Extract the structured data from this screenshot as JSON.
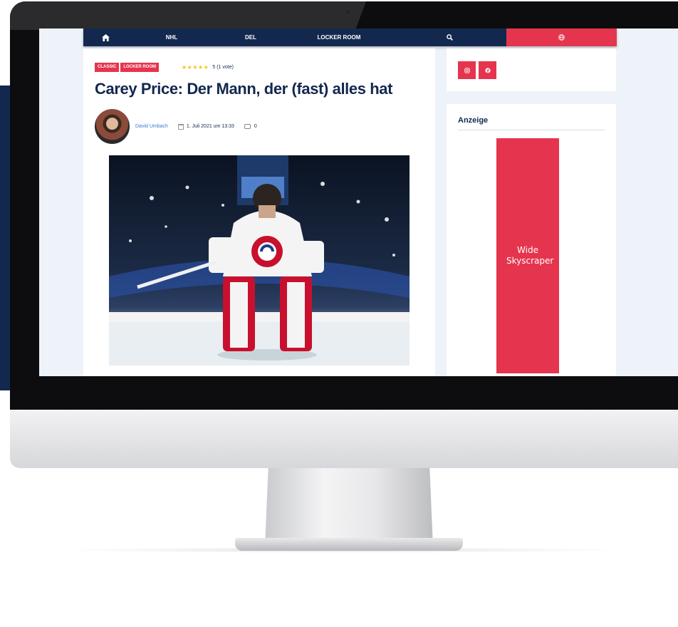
{
  "nav": {
    "home_icon": "home-icon",
    "items": [
      "NHL",
      "DEL",
      "LOCKER ROOM"
    ],
    "search_icon": "search-icon",
    "globe_icon": "globe-icon"
  },
  "article": {
    "tags": [
      "CLASSIC",
      "LOCKER ROOM"
    ],
    "rating_stars": "★★★★★",
    "rating_text": "5 (1 vote)",
    "title": "Carey Price: Der Mann, der (fast) alles hat",
    "author": "David Umbach",
    "date": "1. Juli 2021 um 13:33",
    "comments": "0"
  },
  "sidebar": {
    "social": [
      "instagram-icon",
      "facebook-icon"
    ],
    "ad_heading": "Anzeige",
    "ad_text": "Wide Skyscraper"
  },
  "colors": {
    "navy": "#13284f",
    "accent": "#e5354e",
    "link": "#3a7bd5",
    "star": "#f5c518"
  }
}
